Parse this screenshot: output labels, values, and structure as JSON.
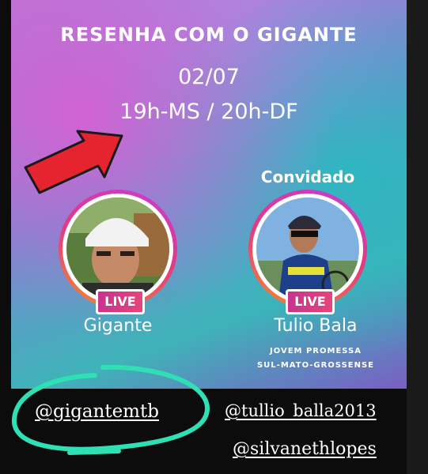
{
  "event": {
    "title": "RESENHA COM O GIGANTE",
    "date": "02/07",
    "time": "19h-MS / 20h-DF"
  },
  "host": {
    "live_label": "LIVE",
    "name": "Gigante"
  },
  "guest": {
    "label": "Convidado",
    "live_label": "LIVE",
    "name": "Tulio Bala",
    "description_line1": "JOVEM PROMESSA",
    "description_line2": "SUL-MATO-GROSSENSE"
  },
  "handles": {
    "host": "@gigantemtb",
    "guest": "@tullio_balla2013",
    "third": "@silvanethlopes"
  },
  "colors": {
    "arrow": "#e52430",
    "highlight_circle": "#2fe0b4",
    "ring_start": "#c63bd6",
    "ring_end": "#f38a2d",
    "live_badge": "#d43c86"
  }
}
